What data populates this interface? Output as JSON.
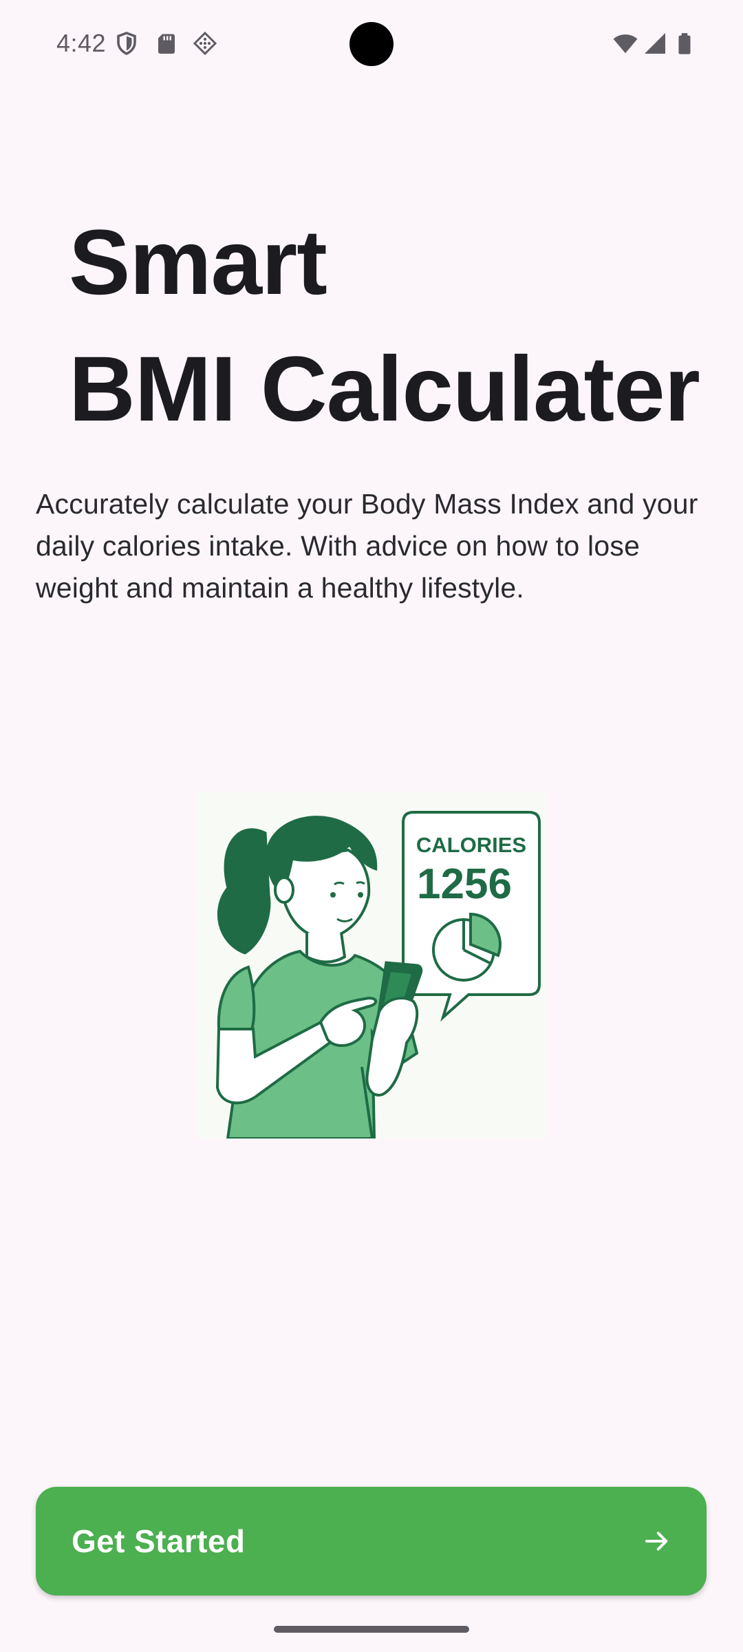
{
  "status_bar": {
    "time": "4:42",
    "left_icons": [
      "shield-icon",
      "sd-card-icon",
      "cast-diamond-icon"
    ],
    "right_icons": [
      "wifi-icon",
      "signal-icon",
      "battery-icon"
    ]
  },
  "hero": {
    "title_line1": "Smart",
    "title_line2": "BMI Calculater",
    "description": "Accurately calculate your Body Mass Index and your daily calories intake. With advice on how to lose weight and maintain a healthy lifestyle."
  },
  "illustration": {
    "icon": "woman-with-phone-illustration",
    "bubble_label": "CALORIES",
    "bubble_value": "1256"
  },
  "cta": {
    "label": "Get Started",
    "icon": "arrow-right-icon"
  },
  "colors": {
    "background": "#FCF6FB",
    "accent": "#4CAF50",
    "illustration_dark_green": "#1E6B45",
    "illustration_light_green": "#6CBF86"
  }
}
